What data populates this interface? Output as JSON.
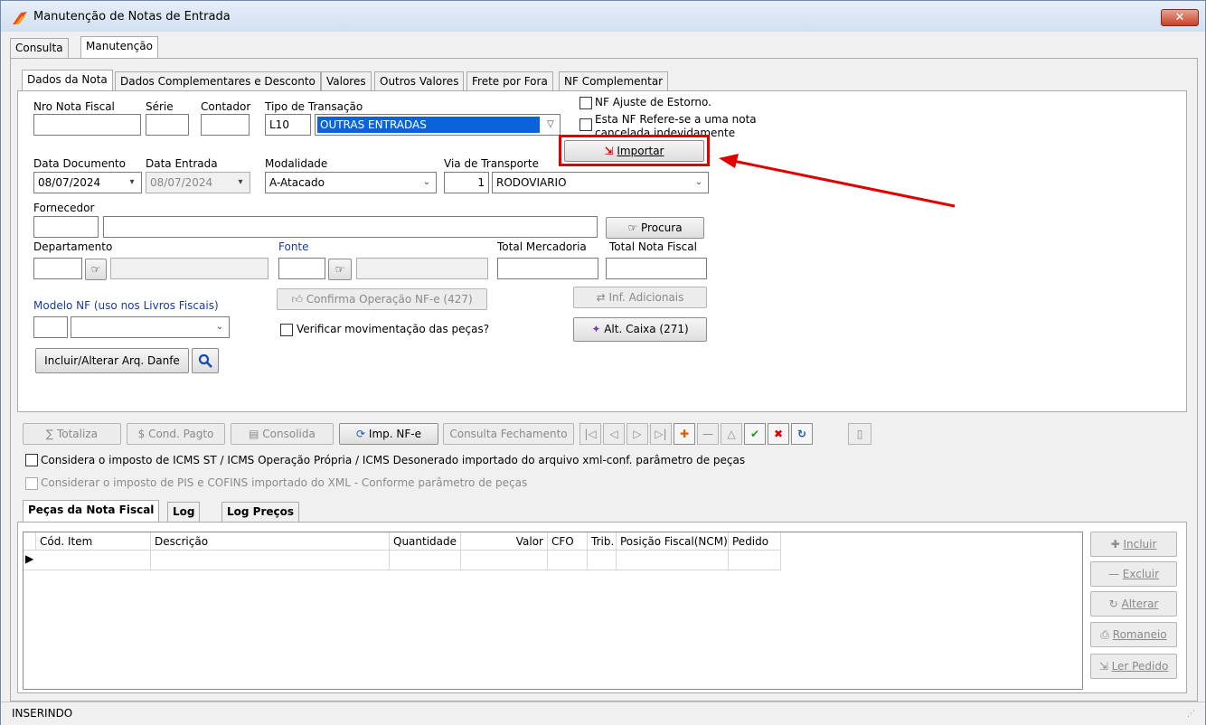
{
  "window": {
    "title": "Manutenção de Notas de Entrada",
    "close": "✕"
  },
  "top_tabs": [
    "Consulta",
    "Manutenção"
  ],
  "inner_tabs": [
    "Dados da Nota",
    "Dados Complementares e Desconto",
    "Valores",
    "Outros Valores",
    "Frete por Fora",
    "NF Complementar"
  ],
  "form": {
    "nro_nota_label": "Nro Nota Fiscal",
    "serie_label": "Série",
    "contador_label": "Contador",
    "tipo_transacao_label": "Tipo de Transação",
    "tipo_transacao_code": "L10",
    "tipo_transacao_value": "OUTRAS ENTRADAS",
    "nf_ajuste_label": "NF Ajuste  de Estorno.",
    "nf_refere_label": "Esta NF Refere-se a uma nota cancelada indevidamente",
    "importar_label": "Importar",
    "data_documento_label": "Data Documento",
    "data_documento_value": "08/07/2024",
    "data_entrada_label": "Data Entrada",
    "data_entrada_value": "08/07/2024",
    "modalidade_label": "Modalidade",
    "modalidade_value": "A-Atacado",
    "via_transporte_label": "Via de Transporte",
    "via_transporte_code": "1",
    "via_transporte_value": "RODOVIARIO",
    "fornecedor_label": "Fornecedor",
    "procura_label": "Procura",
    "departamento_label": "Departamento",
    "fonte_label": "Fonte",
    "total_mercadoria_label": "Total Mercadoria",
    "total_nota_label": "Total Nota Fiscal",
    "modelo_nf_label": "Modelo NF (uso nos Livros Fiscais)",
    "confirma_label": "Confirma Operação NF-e (427)",
    "verificar_label": "Verificar movimentação das peças?",
    "inf_adicionais_label": "Inf. Adicionais",
    "alt_caixa_label": "Alt. Caixa (271)",
    "incluir_danfe_label": "Incluir/Alterar Arq. Danfe"
  },
  "toolbar": {
    "totaliza": "Totaliza",
    "cond_pagto": "Cond. Pagto",
    "consolida": "Consolida",
    "imp_nfe": "Imp. NF-e",
    "consulta_fechamento": "Consulta Fechamento"
  },
  "options": {
    "considera_icms": "Considera o imposto de ICMS ST / ICMS Operação Própria / ICMS Desonerado importado do arquivo xml-conf. parâmetro de peças",
    "considerar_pis": "Considerar o imposto de PIS e COFINS importado do XML - Conforme parâmetro de peças"
  },
  "bottom_tabs": [
    "Peças da Nota Fiscal",
    "Log",
    "Log Preços"
  ],
  "grid": {
    "columns": [
      "Cód. Item",
      "Descrição",
      "Quantidade",
      "Valor",
      "CFO",
      "Trib.",
      "Posição Fiscal(NCM)",
      "Pedido"
    ]
  },
  "side_buttons": [
    "Incluir",
    "Excluir",
    "Alterar",
    "Romaneio",
    "Ler Pedido"
  ],
  "status": "INSERINDO",
  "colors": {
    "highlight": "#e00000",
    "selection": "#0a64d8"
  }
}
